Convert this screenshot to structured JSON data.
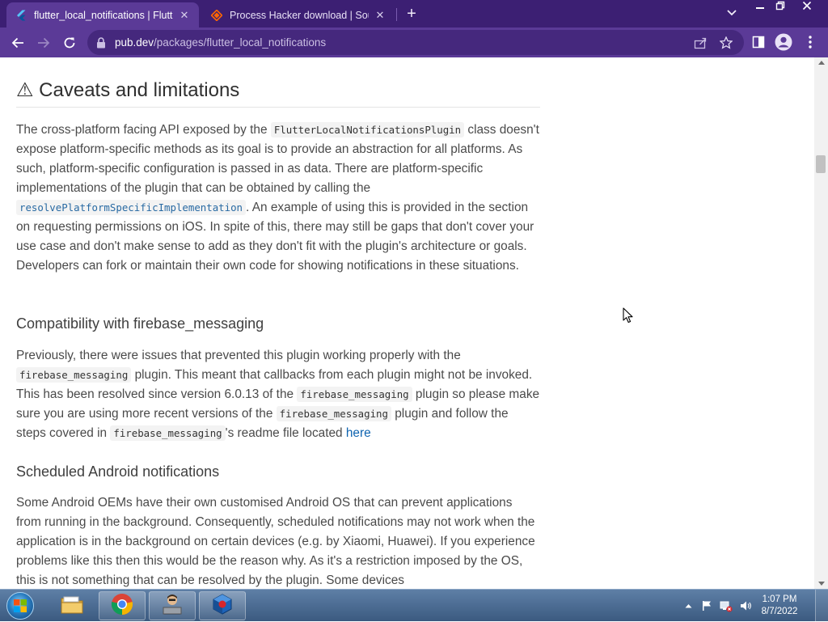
{
  "browser": {
    "tabs": [
      {
        "title": "flutter_local_notifications | Flutter",
        "favicon": "flutter-icon",
        "active": true
      },
      {
        "title": "Process Hacker download | SourceForge",
        "favicon": "sourceforge-icon",
        "active": false
      }
    ],
    "new_tab_label": "+",
    "url": {
      "host": "pub.dev",
      "path": "/packages/flutter_local_notifications"
    },
    "theme_color": "#5b3a97"
  },
  "page": {
    "heading": "⚠ Caveats and limitations",
    "caveats": {
      "p1": "The cross-platform facing API exposed by the",
      "c1": "FlutterLocalNotificationsPlugin",
      "p2": "class doesn't expose platform-specific methods as its goal is to provide an abstraction for all platforms. As such, platform-specific configuration is passed in as data. There are platform-specific implementations of the plugin that can be obtained by calling the",
      "c2": "resolvePlatformSpecificImplementation",
      "p3": ". An example of using this is provided in the section on requesting permissions on iOS. In spite of this, there may still be gaps that don't cover your use case and don't make sense to add as they don't fit with the plugin's architecture or goals. Developers can fork or maintain their own code for showing notifications in these situations."
    },
    "firebase": {
      "heading": "Compatibility with firebase_messaging",
      "p1": "Previously, there were issues that prevented this plugin working properly with the",
      "c1": "firebase_messaging",
      "p2": "plugin. This meant that callbacks from each plugin might not be invoked. This has been resolved since version 6.0.13 of the",
      "c2": "firebase_messaging",
      "p3": "plugin so please make sure you are using more recent versions of the",
      "c3": "firebase_messaging",
      "p4": "plugin and follow the steps covered in",
      "c4": "firebase_messaging",
      "p5": "'s readme file located",
      "link": "here"
    },
    "scheduled": {
      "heading": "Scheduled Android notifications",
      "p1": "Some Android OEMs have their own customised Android OS that can prevent applications from running in the background. Consequently, scheduled notifications may not work when the application is in the background on certain devices (e.g. by Xiaomi, Huawei). If you experience problems like this then this would be the reason why. As it's a restriction imposed by the OS, this is not something that can be resolved by the plugin. Some devices"
    }
  },
  "taskbar": {
    "pinned": [
      "windows-explorer-icon",
      "chrome-icon",
      "user-app-icon",
      "virtualbox-icon"
    ],
    "clock": {
      "time": "1:07 PM",
      "date": "8/7/2022"
    }
  }
}
